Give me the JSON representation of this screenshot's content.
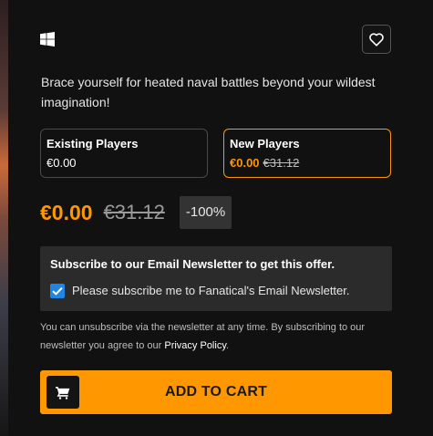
{
  "product": {
    "platform_icon": "windows-icon",
    "wishlist_icon": "heart-icon",
    "description": "Brace yourself for heated naval battles beyond your wildest imagination!"
  },
  "options": {
    "existing": {
      "title": "Existing Players",
      "price": "€0.00"
    },
    "new": {
      "title": "New Players",
      "price": "€0.00",
      "original_price": "€31.12",
      "selected": true
    }
  },
  "pricing": {
    "current": "€0.00",
    "original": "€31.12",
    "discount": "-100%"
  },
  "newsletter": {
    "title": "Subscribe to our Email Newsletter to get this offer.",
    "checkbox_label": "Please subscribe me to Fanatical's Email Newsletter.",
    "checked": true
  },
  "fineprint": {
    "text": "You can unsubscribe via the newsletter at any time. By subscribing to our newsletter you agree to our ",
    "link_text": "Privacy Policy",
    "suffix": "."
  },
  "cart": {
    "label": "ADD TO CART",
    "icon": "cart-icon"
  },
  "colors": {
    "accent": "#ff9800",
    "background": "#111111",
    "panel": "#2b2b2b",
    "checkbox": "#1f86e8"
  }
}
